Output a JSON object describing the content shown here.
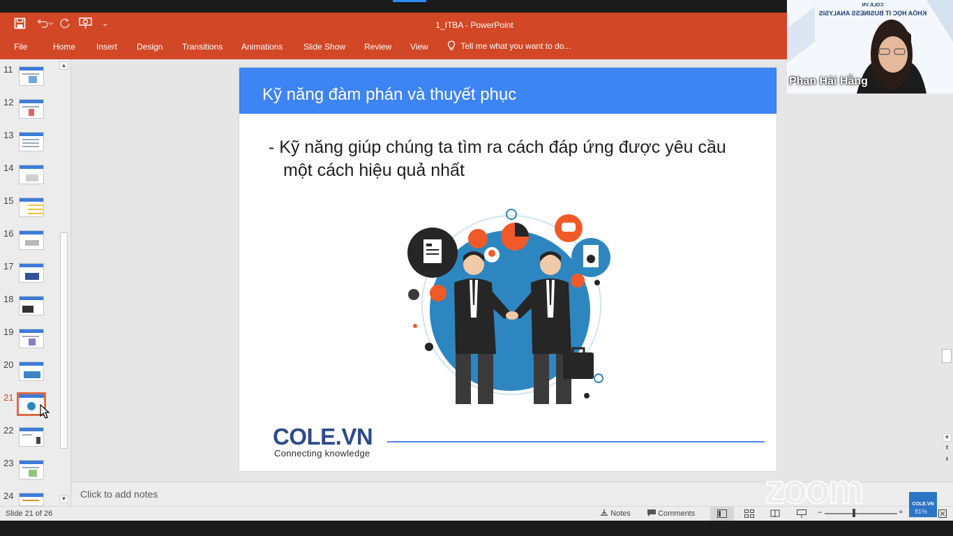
{
  "app": {
    "doc_title": "1_ITBA - PowerPoint",
    "quick_access": {
      "save": "save-icon",
      "undo": "undo-icon",
      "redo": "redo-icon",
      "present": "present-icon",
      "customize": "⌄"
    }
  },
  "ribbon": {
    "tabs": [
      "File",
      "Home",
      "Insert",
      "Design",
      "Transitions",
      "Animations",
      "Slide Show",
      "Review",
      "View"
    ],
    "tell_me": "Tell me what you want to do..."
  },
  "slides_panel": {
    "numbers": [
      "11",
      "12",
      "13",
      "14",
      "15",
      "16",
      "17",
      "18",
      "19",
      "20",
      "21",
      "22",
      "23",
      "24"
    ],
    "active": "21"
  },
  "slide": {
    "title": "Kỹ năng đàm phán và thuyết phục",
    "bullet": "- Kỹ năng giúp chúng ta tìm ra cách đáp ứng được yêu cầu một cách hiệu quả nhất",
    "brand": "COLE.VN",
    "brand_tagline": "Connecting knowledge",
    "colors": {
      "header": "#3d84f5",
      "brand": "#2e4a8a"
    }
  },
  "notes": {
    "placeholder": "Click to add notes"
  },
  "status": {
    "slide_info": "Slide 21 of 26",
    "notes": "Notes",
    "comments": "Comments",
    "zoom_minus": "–",
    "zoom_plus": "+"
  },
  "video": {
    "participant": "Phan Hải Hằng",
    "banner_top": "COLE.VN",
    "banner_text": "KHÓA HỌC IT BUSINESS ANALYSIS"
  },
  "overlay": {
    "zoom_logo": "zoom",
    "badge": "COLE.VN",
    "badge_pct": "81%"
  }
}
